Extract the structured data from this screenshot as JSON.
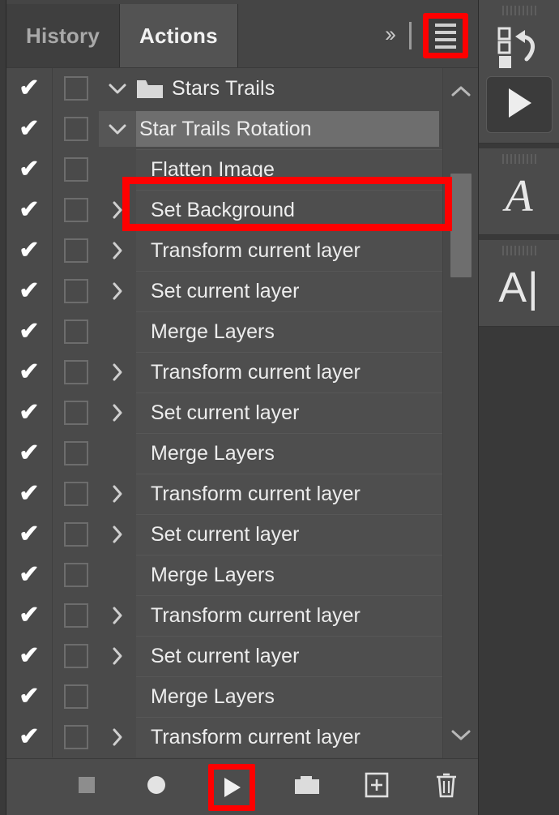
{
  "colors": {
    "accent_highlight": "#ff0000",
    "panel_bg": "#4a4a4a",
    "row_band": "#4e4e4e",
    "selected_row": "#6e6e6e",
    "tab_active_bg": "#535353",
    "tab_inactive_bg": "#3f3f3f",
    "text": "#ededed",
    "scrollbar_thumb": "#6e6e6e"
  },
  "tabs": [
    {
      "label": "History",
      "active": false,
      "name": "tab-history"
    },
    {
      "label": "Actions",
      "active": true,
      "name": "tab-actions"
    }
  ],
  "tab_tools": {
    "more_label": "››",
    "menu_icon_name": "panel-menu-icon",
    "menu_highlighted": true
  },
  "list": {
    "rows": [
      {
        "type": "set",
        "label": "Stars Trails",
        "checked": true,
        "twisty": "down",
        "folder": true,
        "indent": 0,
        "selected": false
      },
      {
        "type": "action",
        "label": "Star Trails Rotation",
        "checked": true,
        "twisty": "down",
        "folder": false,
        "indent": 0,
        "selected": true
      },
      {
        "type": "command",
        "label": "Flatten Image",
        "checked": true,
        "twisty": "none",
        "folder": false,
        "indent": 1,
        "selected": false
      },
      {
        "type": "command",
        "label": "Set Background",
        "checked": true,
        "twisty": "right",
        "folder": false,
        "indent": 1,
        "selected": false
      },
      {
        "type": "command",
        "label": "Transform current layer",
        "checked": true,
        "twisty": "right",
        "folder": false,
        "indent": 1,
        "selected": false
      },
      {
        "type": "command",
        "label": "Set current layer",
        "checked": true,
        "twisty": "right",
        "folder": false,
        "indent": 1,
        "selected": false
      },
      {
        "type": "command",
        "label": "Merge Layers",
        "checked": true,
        "twisty": "none",
        "folder": false,
        "indent": 1,
        "selected": false
      },
      {
        "type": "command",
        "label": "Transform current layer",
        "checked": true,
        "twisty": "right",
        "folder": false,
        "indent": 1,
        "selected": false
      },
      {
        "type": "command",
        "label": "Set current layer",
        "checked": true,
        "twisty": "right",
        "folder": false,
        "indent": 1,
        "selected": false
      },
      {
        "type": "command",
        "label": "Merge Layers",
        "checked": true,
        "twisty": "none",
        "folder": false,
        "indent": 1,
        "selected": false
      },
      {
        "type": "command",
        "label": "Transform current layer",
        "checked": true,
        "twisty": "right",
        "folder": false,
        "indent": 1,
        "selected": false
      },
      {
        "type": "command",
        "label": "Set current layer",
        "checked": true,
        "twisty": "right",
        "folder": false,
        "indent": 1,
        "selected": false
      },
      {
        "type": "command",
        "label": "Merge Layers",
        "checked": true,
        "twisty": "none",
        "folder": false,
        "indent": 1,
        "selected": false
      },
      {
        "type": "command",
        "label": "Transform current layer",
        "checked": true,
        "twisty": "right",
        "folder": false,
        "indent": 1,
        "selected": false
      },
      {
        "type": "command",
        "label": "Set current layer",
        "checked": true,
        "twisty": "right",
        "folder": false,
        "indent": 1,
        "selected": false
      },
      {
        "type": "command",
        "label": "Merge Layers",
        "checked": true,
        "twisty": "none",
        "folder": false,
        "indent": 1,
        "selected": false
      },
      {
        "type": "command",
        "label": "Transform current layer",
        "checked": true,
        "twisty": "right",
        "folder": false,
        "indent": 1,
        "selected": false
      }
    ],
    "check_glyph": "✔"
  },
  "scrollbar": {
    "up_arrow_name": "scroll-up-arrow",
    "down_arrow_name": "scroll-down-arrow",
    "thumb_name": "scrollbar-thumb"
  },
  "bottom_toolbar": {
    "buttons": [
      {
        "name": "stop-button",
        "icon": "stop-square-icon",
        "highlighted": false,
        "disabled": true
      },
      {
        "name": "record-button",
        "icon": "record-circle-icon",
        "highlighted": false,
        "disabled": false
      },
      {
        "name": "play-button",
        "icon": "play-triangle-icon",
        "highlighted": true,
        "disabled": false
      },
      {
        "name": "new-set-button",
        "icon": "folder-icon",
        "highlighted": false,
        "disabled": false
      },
      {
        "name": "new-action-button",
        "icon": "plus-square-icon",
        "highlighted": false,
        "disabled": false
      },
      {
        "name": "delete-button",
        "icon": "trash-icon",
        "highlighted": false,
        "disabled": false
      }
    ]
  },
  "rail": {
    "groups": [
      {
        "name": "rail-group-actions",
        "icons": [
          {
            "name": "actions-panel-icon",
            "kind": "actions",
            "glyph": ""
          },
          {
            "name": "rail-play-button",
            "kind": "play",
            "glyph": ""
          }
        ]
      },
      {
        "name": "rail-group-character",
        "icons": [
          {
            "name": "character-panel-icon",
            "kind": "script",
            "glyph": "A"
          }
        ]
      },
      {
        "name": "rail-group-type",
        "icons": [
          {
            "name": "type-panel-icon",
            "kind": "type",
            "glyph": "A|"
          }
        ]
      }
    ]
  }
}
